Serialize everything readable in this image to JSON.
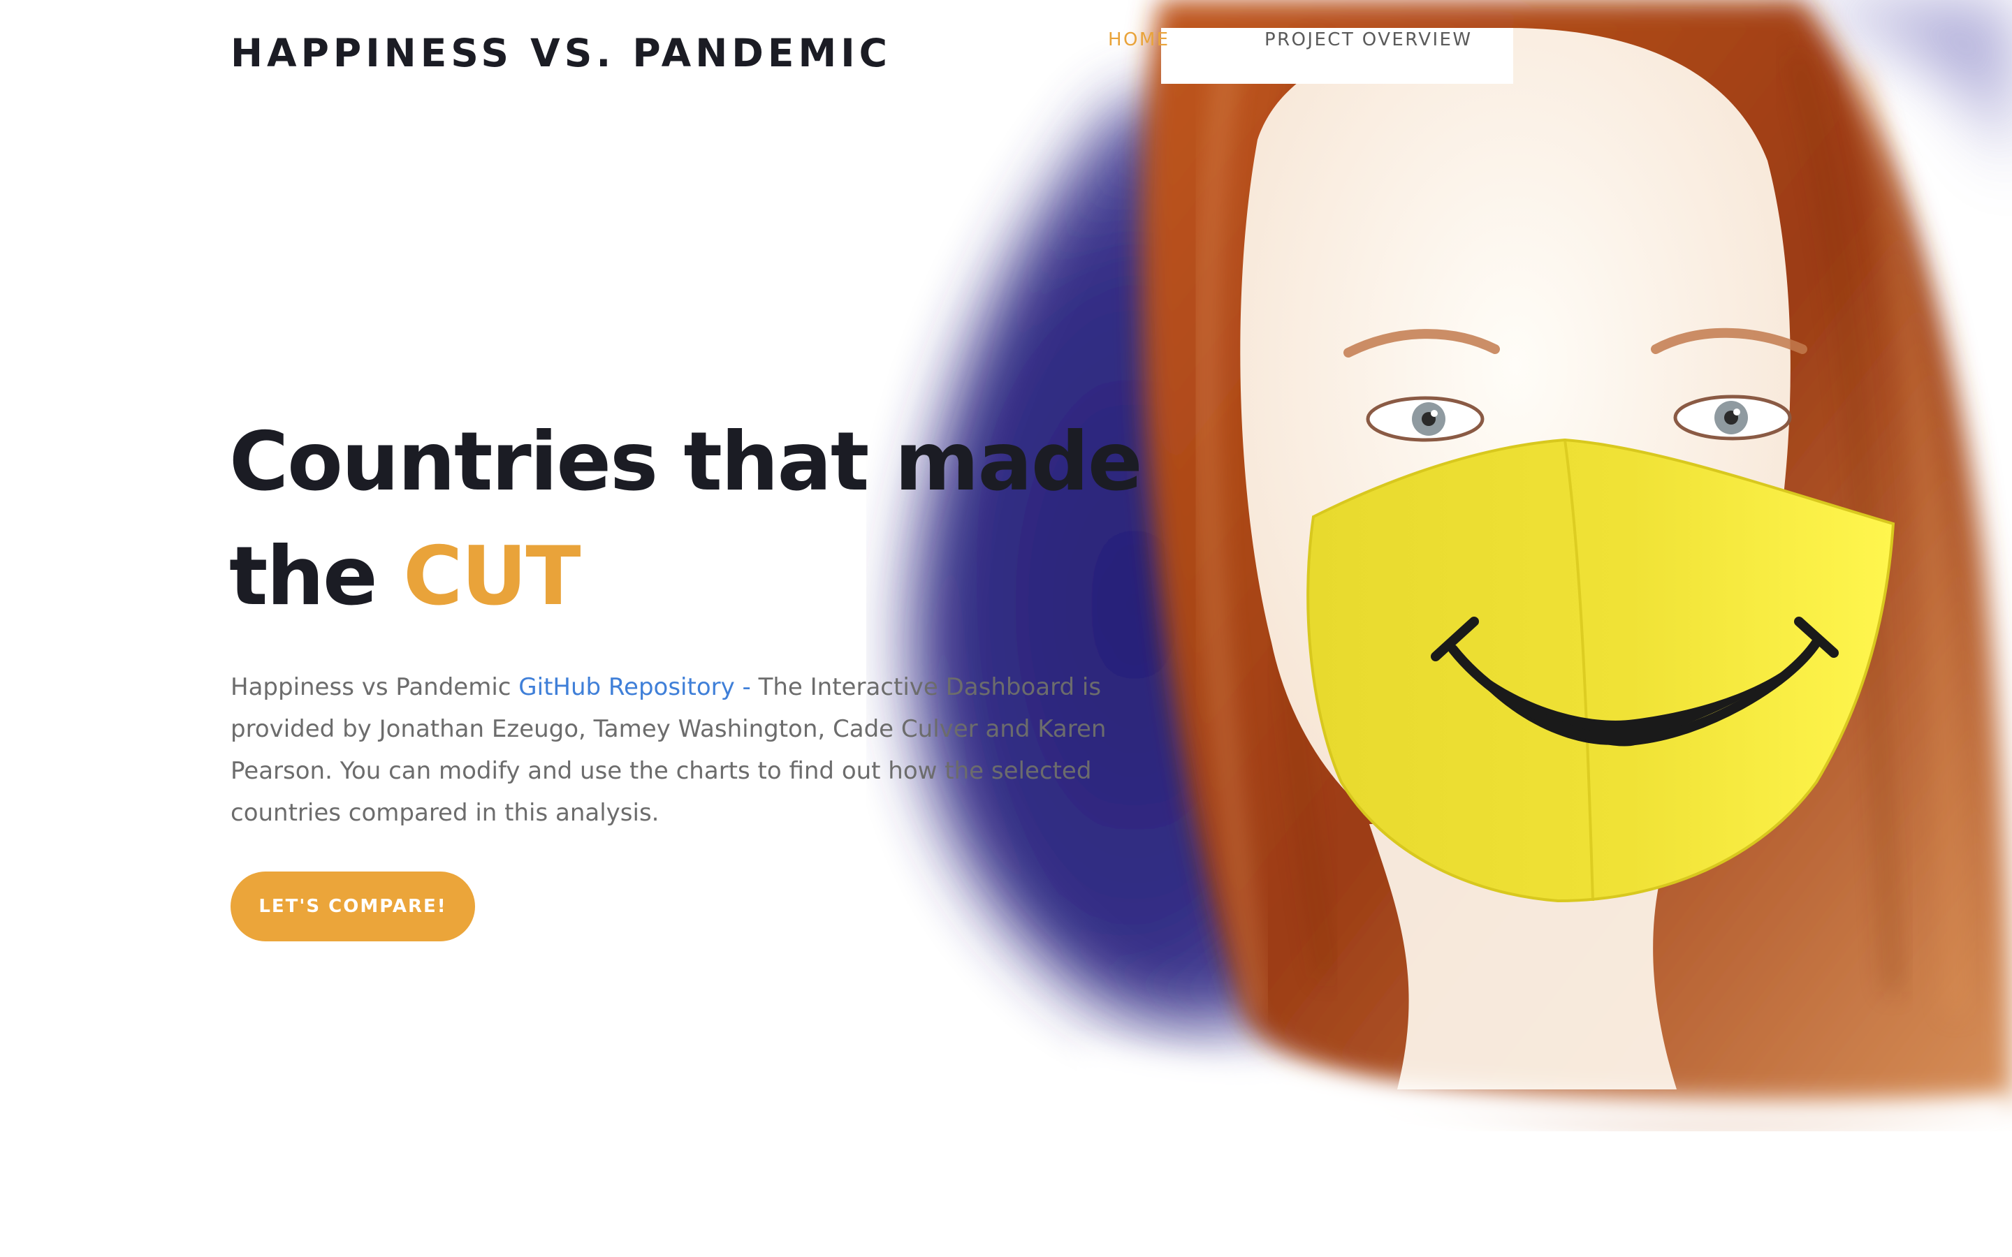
{
  "header": {
    "brand": "HAPPINESS VS. PANDEMIC",
    "nav": [
      {
        "label": "HOME",
        "active": true
      },
      {
        "label": "PROJECT OVERVIEW",
        "active": false
      }
    ]
  },
  "hero": {
    "headline_line1": "Countries that made",
    "headline_line2_prefix": "the ",
    "headline_accent": "CUT",
    "description": {
      "lead": "Happiness vs Pandemic ",
      "link_text": "GitHub Repository",
      "separator": " - ",
      "body": "The Interactive Dashboard is provided by Jonathan Ezeugo, Tamey Washington, Cade Culver and Karen Pearson. You can modify and use the charts to find out how the selected countries compared in this analysis."
    },
    "cta_label": "LET'S COMPARE!"
  },
  "colors": {
    "accent": "#e9a33a",
    "heading": "#1b1c24",
    "body_text": "#6c6c6c",
    "link": "#3f7fd8",
    "blob": "#1f1a6e",
    "mask": "#f2e43b"
  },
  "image": {
    "subject": "woman-wearing-yellow-smiley-face-mask"
  }
}
